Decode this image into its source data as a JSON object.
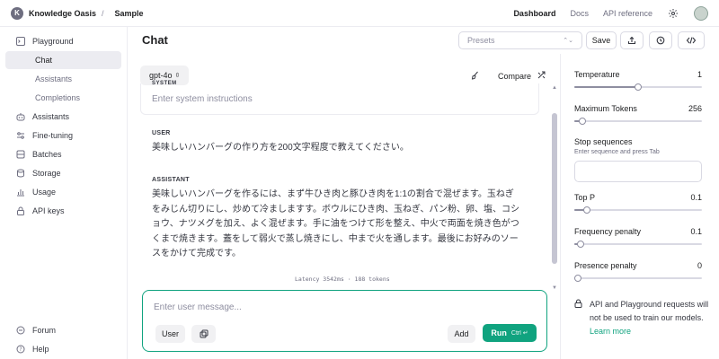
{
  "topbar": {
    "org_initial": "K",
    "org_name": "Knowledge Oasis",
    "separator": "/",
    "project": "Sample",
    "nav": [
      "Dashboard",
      "Docs",
      "API reference"
    ]
  },
  "sidebar": {
    "items": [
      {
        "label": "Playground",
        "icon": "terminal-icon"
      },
      {
        "label": "Chat",
        "icon": "",
        "sub": true,
        "active": true
      },
      {
        "label": "Assistants",
        "icon": "",
        "sub": true
      },
      {
        "label": "Completions",
        "icon": "",
        "sub": true
      },
      {
        "label": "Assistants",
        "icon": "robot-icon"
      },
      {
        "label": "Fine-tuning",
        "icon": "tune-icon"
      },
      {
        "label": "Batches",
        "icon": "batches-icon"
      },
      {
        "label": "Storage",
        "icon": "database-icon"
      },
      {
        "label": "Usage",
        "icon": "chart-icon"
      },
      {
        "label": "API keys",
        "icon": "lock-icon"
      }
    ],
    "bottom": [
      {
        "label": "Forum",
        "icon": "forum-icon"
      },
      {
        "label": "Help",
        "icon": "help-icon"
      }
    ]
  },
  "main": {
    "title": "Chat",
    "presets_placeholder": "Presets",
    "save_label": "Save",
    "model": "gpt-4o",
    "compare_label": "Compare",
    "system_label": "SYSTEM",
    "system_placeholder": "Enter system instructions",
    "messages": [
      {
        "role": "USER",
        "text": "美味しいハンバーグの作り方を200文字程度で教えてください。"
      },
      {
        "role": "ASSISTANT",
        "text": "美味しいハンバーグを作るには、まず牛ひき肉と豚ひき肉を1:1の割合で混ぜます。玉ねぎをみじん切りにし、炒めて冷ましますす。ボウルにひき肉、玉ねぎ、パン粉、卵、塩、コショウ、ナツメグを加え、よく混ぜます。手に油をつけて形を整え、中火で両面を焼き色がつくまで焼きます。蓋をして弱火で蒸し焼きにし、中まで火を通します。最後にお好みのソースをかけて完成です。"
      }
    ],
    "latency": "Latency 3542ms · 188 tokens",
    "input_placeholder": "Enter user message...",
    "role_button": "User",
    "add_label": "Add",
    "run_label": "Run",
    "run_shortcut": "Ctrl ↵"
  },
  "params": {
    "temperature": {
      "label": "Temperature",
      "value": "1",
      "fraction": 0.5
    },
    "max_tokens": {
      "label": "Maximum Tokens",
      "value": "256",
      "fraction": 0.06
    },
    "stop": {
      "label": "Stop sequences",
      "hint": "Enter sequence and press Tab"
    },
    "top_p": {
      "label": "Top P",
      "value": "0.1",
      "fraction": 0.1
    },
    "frequency_penalty": {
      "label": "Frequency penalty",
      "value": "0.1",
      "fraction": 0.05
    },
    "presence_penalty": {
      "label": "Presence penalty",
      "value": "0",
      "fraction": 0.0
    },
    "notice_text": "API and Playground requests will not be used to train our models.",
    "notice_link": "Learn more"
  },
  "colors": {
    "accent": "#10a37f"
  }
}
